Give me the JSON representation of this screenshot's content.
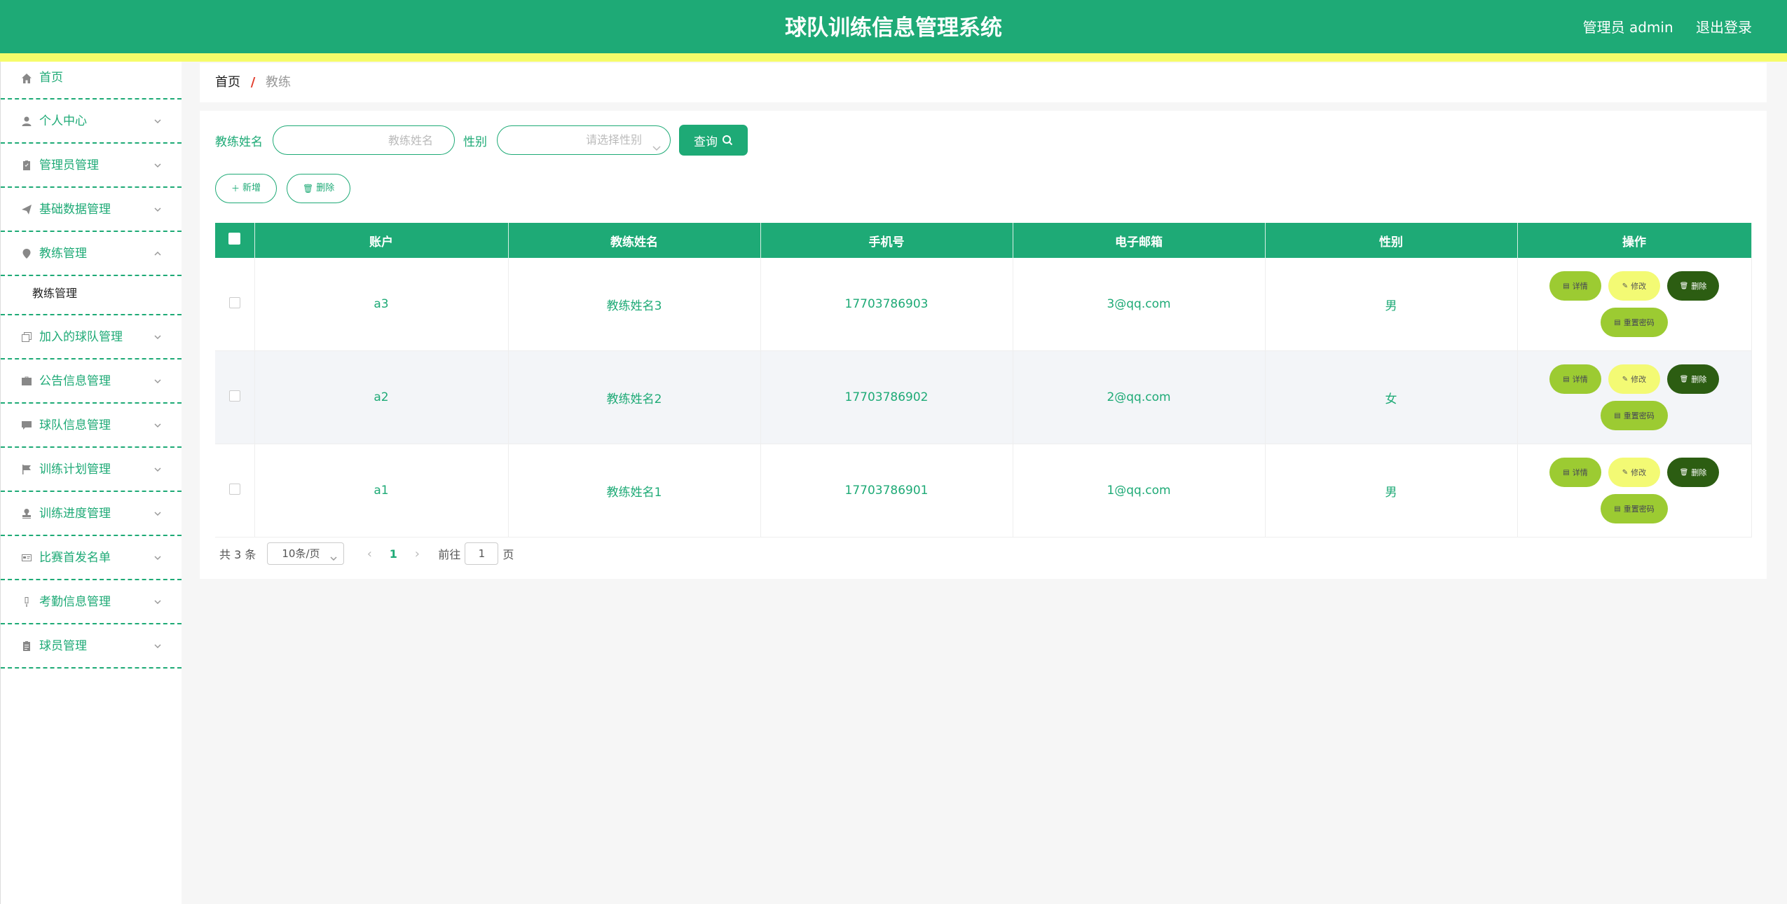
{
  "header": {
    "title": "球队训练信息管理系统",
    "user_label": "管理员 admin",
    "logout_label": "退出登录",
    "bg_color": "#1eaa76",
    "strip_color": "#f6fc6a"
  },
  "sidebar": {
    "items": [
      {
        "label": "首页",
        "icon": "home-icon"
      },
      {
        "label": "个人中心",
        "icon": "user-icon"
      },
      {
        "label": "管理员管理",
        "icon": "clipboard-icon"
      },
      {
        "label": "基础数据管理",
        "icon": "send-icon"
      },
      {
        "label": "教练管理",
        "icon": "location-icon",
        "expanded": true,
        "sub": "教练管理"
      },
      {
        "label": "加入的球队管理",
        "icon": "copy-icon"
      },
      {
        "label": "公告信息管理",
        "icon": "briefcase-icon"
      },
      {
        "label": "球队信息管理",
        "icon": "chat-icon"
      },
      {
        "label": "训练计划管理",
        "icon": "flag-icon"
      },
      {
        "label": "训练进度管理",
        "icon": "stamp-icon"
      },
      {
        "label": "比赛首发名单",
        "icon": "id-card-icon"
      },
      {
        "label": "考勤信息管理",
        "icon": "mic-icon"
      },
      {
        "label": "球员管理",
        "icon": "clipboard-icon"
      }
    ]
  },
  "breadcrumb": {
    "home": "首页",
    "separator": "/",
    "current": "教练"
  },
  "search": {
    "name_label": "教练姓名",
    "name_placeholder": "教练姓名",
    "gender_label": "性别",
    "gender_placeholder": "请选择性别",
    "query_label": "查询"
  },
  "actions": {
    "add_label": "新增",
    "delete_label": "删除"
  },
  "table": {
    "headers": [
      "账户",
      "教练姓名",
      "手机号",
      "电子邮箱",
      "性别",
      "操作"
    ],
    "rows": [
      {
        "account": "a3",
        "name": "教练姓名3",
        "phone": "17703786903",
        "email": "3@qq.com",
        "gender": "男"
      },
      {
        "account": "a2",
        "name": "教练姓名2",
        "phone": "17703786902",
        "email": "2@qq.com",
        "gender": "女"
      },
      {
        "account": "a1",
        "name": "教练姓名1",
        "phone": "17703786901",
        "email": "1@qq.com",
        "gender": "男"
      }
    ],
    "ops": {
      "detail": "详情",
      "edit": "修改",
      "delete": "删除",
      "reset": "重置密码"
    }
  },
  "pagination": {
    "total": "共 3 条",
    "page_size": "10条/页",
    "current_page": "1",
    "goto_label": "前往",
    "goto_value": "1",
    "page_suffix": "页"
  }
}
